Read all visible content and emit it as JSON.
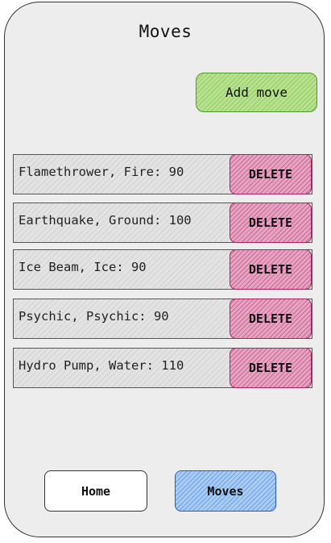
{
  "screen": {
    "title": "Moves"
  },
  "actions": {
    "add_label": "Add move",
    "add_color": "#b9e28f"
  },
  "moves": [
    {
      "text": "Flamethrower, Fire: 90",
      "delete_label": "DELETE"
    },
    {
      "text": "Earthquake, Ground: 100",
      "delete_label": "DELETE"
    },
    {
      "text": "Ice Beam, Ice: 90",
      "delete_label": "DELETE"
    },
    {
      "text": "Psychic, Psychic: 90",
      "delete_label": "DELETE"
    },
    {
      "text": "Hydro Pump, Water: 110",
      "delete_label": "DELETE"
    }
  ],
  "nav": {
    "home_label": "Home",
    "moves_label": "Moves",
    "active": "Moves",
    "active_color": "#a8cdf2",
    "delete_color": "#e6a3c2"
  }
}
